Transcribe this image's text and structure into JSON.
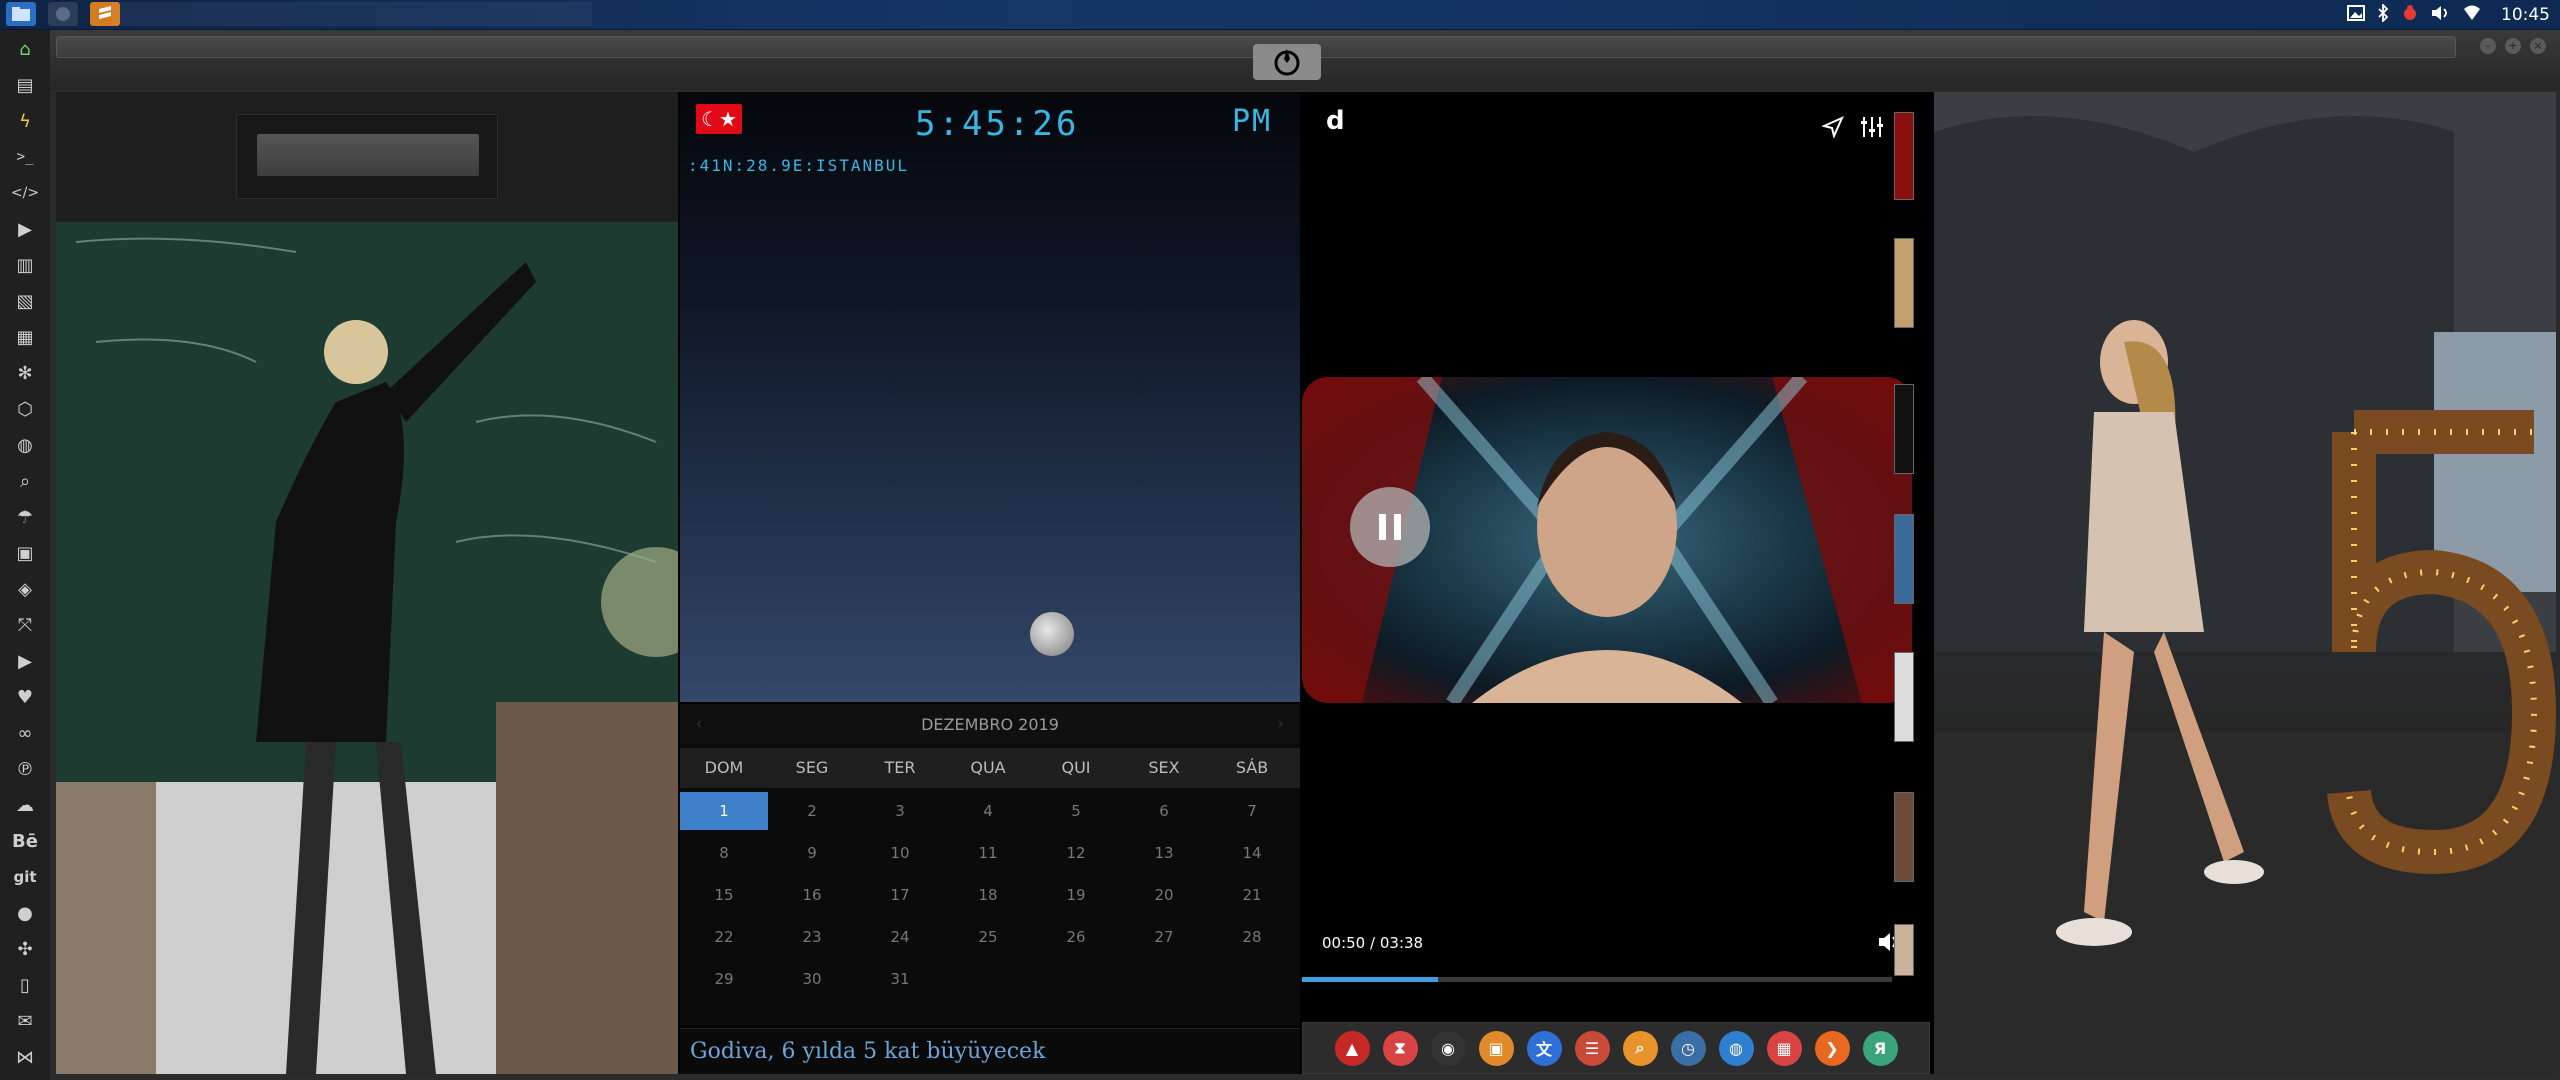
{
  "topbar": {
    "clock": "10:45"
  },
  "window": {
    "controls": [
      "–",
      "+",
      "×"
    ]
  },
  "world_clock": {
    "time": "5:45:26",
    "ampm": "PM",
    "location": ":41N:28.9E:ISTANBUL",
    "flag": "☾★"
  },
  "calendar": {
    "month_label": "DEZEMBRO 2019",
    "weekdays": [
      "DOM",
      "SEG",
      "TER",
      "QUA",
      "QUI",
      "SEX",
      "SÁB"
    ],
    "weeks": [
      [
        "1",
        "2",
        "3",
        "4",
        "5",
        "6",
        "7"
      ],
      [
        "8",
        "9",
        "10",
        "11",
        "12",
        "13",
        "14"
      ],
      [
        "15",
        "16",
        "17",
        "18",
        "19",
        "20",
        "21"
      ],
      [
        "22",
        "23",
        "24",
        "25",
        "26",
        "27",
        "28"
      ],
      [
        "29",
        "30",
        "31",
        "",
        "",
        "",
        ""
      ]
    ],
    "selected_day": "1"
  },
  "news_ticker": {
    "text": "Godiva, 6 yılda 5 kat büyüyecek"
  },
  "player": {
    "logo": "d",
    "elapsed": "00:50",
    "separator": "/",
    "duration": "03:38",
    "progress_fraction": 0.23
  },
  "dock_icons": [
    {
      "name": "app-a-icon",
      "glyph": "▲",
      "color": "#c62828"
    },
    {
      "name": "hourglass-icon",
      "glyph": "⧗",
      "color": "#d84343"
    },
    {
      "name": "dark-globe-icon",
      "glyph": "◉",
      "color": "#333"
    },
    {
      "name": "image-viewer-icon",
      "glyph": "▣",
      "color": "#e08a2b"
    },
    {
      "name": "translate-icon",
      "glyph": "文",
      "color": "#2f6fd6"
    },
    {
      "name": "news-reader-icon",
      "glyph": "☰",
      "color": "#c94a3a"
    },
    {
      "name": "search-icon",
      "glyph": "⌕",
      "color": "#e8932b"
    },
    {
      "name": "clock-icon",
      "glyph": "◷",
      "color": "#3a6ea5"
    },
    {
      "name": "web-browser-icon",
      "glyph": "◍",
      "color": "#2f7fd0"
    },
    {
      "name": "calendar-icon",
      "glyph": "▦",
      "color": "#d84343"
    },
    {
      "name": "forward-arrow-icon",
      "glyph": "❯",
      "color": "#e8681f"
    },
    {
      "name": "yandex-icon",
      "glyph": "Я",
      "color": "#3aa57a"
    }
  ],
  "sidebar_icons": [
    "home-icon",
    "document-icon",
    "lightning-icon",
    "terminal-icon",
    "code-icon",
    "play-icon",
    "book-icon",
    "image-icon",
    "news-icon",
    "settings-icon",
    "hexagon-icon",
    "globe-icon",
    "search-icon",
    "umbrella-icon",
    "contact-icon",
    "tag-icon",
    "expand-icon",
    "youtube-icon",
    "heart-icon",
    "link-icon",
    "pinterest-icon",
    "cloud-icon",
    "behance-icon",
    "git-icon",
    "github-icon",
    "puzzle-icon",
    "map-icon",
    "mail-icon",
    "share-icon"
  ],
  "sidebar_texts": {
    "behance": "Bē",
    "git": "git"
  }
}
